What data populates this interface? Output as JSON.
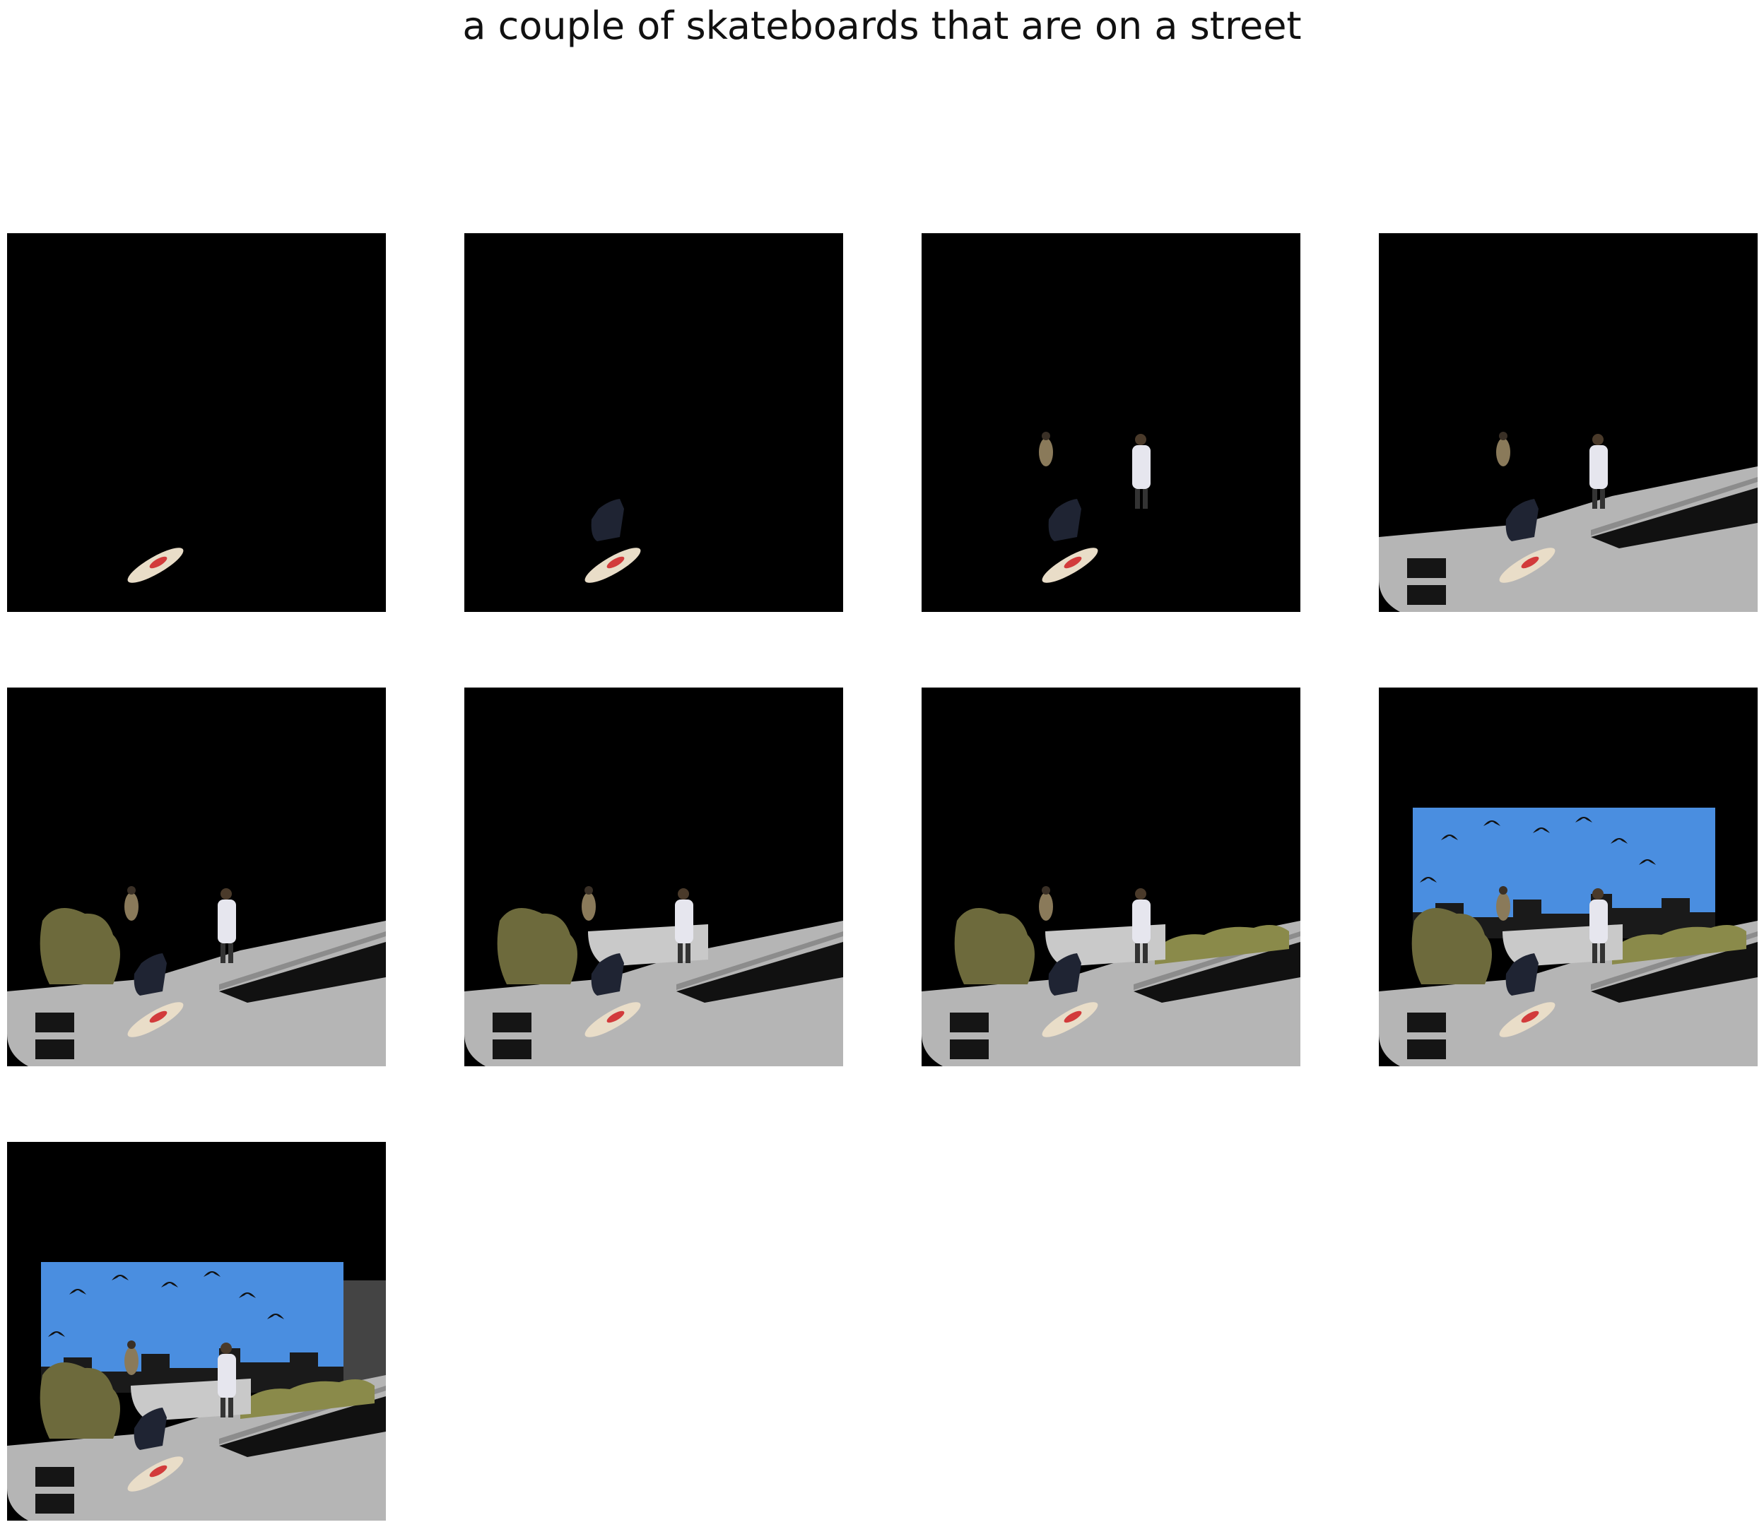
{
  "figure": {
    "title": "a couple of skateboards that are on a street",
    "panels": [
      {
        "layers": [
          "skateboard"
        ]
      },
      {
        "layers": [
          "skateboard",
          "chair"
        ]
      },
      {
        "layers": [
          "skateboard",
          "chair",
          "person-small",
          "person-white"
        ]
      },
      {
        "layers": [
          "skateboard",
          "chair",
          "person-small",
          "person-white",
          "road"
        ]
      },
      {
        "layers": [
          "skateboard",
          "chair",
          "person-small",
          "person-white",
          "road",
          "bush"
        ]
      },
      {
        "layers": [
          "skateboard",
          "chair",
          "person-small",
          "person-white",
          "road",
          "bush",
          "gravel"
        ]
      },
      {
        "layers": [
          "skateboard",
          "chair",
          "person-small",
          "person-white",
          "road",
          "bush",
          "gravel",
          "hedge"
        ]
      },
      {
        "layers": [
          "skateboard",
          "chair",
          "person-small",
          "person-white",
          "road",
          "bush",
          "gravel",
          "hedge",
          "sky",
          "birds",
          "buildings"
        ]
      },
      {
        "layers": [
          "skateboard",
          "chair",
          "person-small",
          "person-white",
          "road",
          "bush",
          "gravel",
          "hedge",
          "sky",
          "birds",
          "buildings",
          "wall"
        ]
      }
    ],
    "colors": {
      "background": "#000000",
      "sky": "#4a8ee0",
      "road": "#b5b5b5",
      "road_dark": "#8c8c8c",
      "bush": "#6d6a3c",
      "hedge": "#8a8a4a",
      "gravel": "#c9c9c9",
      "chair": "#1f2433",
      "skateboard": "#e9ddc8",
      "skateboard_accent": "#d23b3b",
      "person_white": "#e6e6ee",
      "person_small": "#8a7a5a",
      "birds": "#111111",
      "buildings": "#1a1a1a"
    }
  }
}
